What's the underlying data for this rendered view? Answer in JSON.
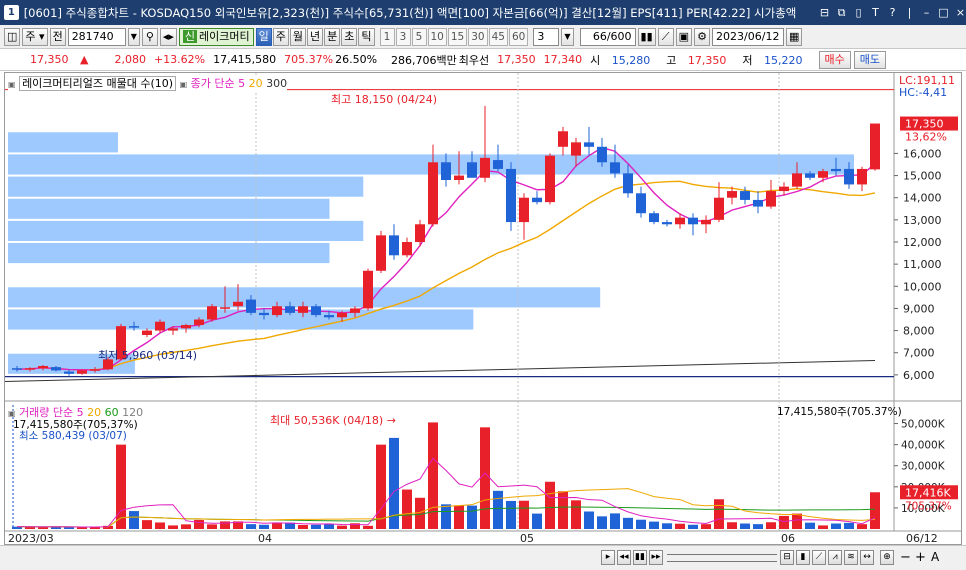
{
  "titlebar": {
    "icon_label": "1",
    "title": "[0601] 주식종합차트 - KOSDAQ150 외국인보유[2,323(천)] 주식수[65,731(천)] 액면[100] 자본금[66(억)] 결산[12월] EPS[411] PER[42.22] 시가총액",
    "buttons": [
      "⊟",
      "⧉",
      "▯",
      "T",
      "?",
      "|",
      "–",
      "□",
      "×"
    ]
  },
  "toolbar1": {
    "period_label": "주",
    "prev_label": "전",
    "stock_code": "281740",
    "company_badge": "신",
    "company_name": "레이크머티",
    "periods": [
      "일",
      "주",
      "월",
      "년",
      "분",
      "초",
      "틱"
    ],
    "active_period": "일",
    "intervals": [
      "1",
      "3",
      "5",
      "10",
      "15",
      "30",
      "45",
      "60"
    ],
    "interval_value": "3",
    "count_value": "66",
    "count_total": "/600",
    "date_value": "2023/06/12"
  },
  "quote": {
    "price": "17,350",
    "change_arrow": "▲",
    "change": "2,080",
    "change_pct": "+13.62%",
    "volume": "17,415,580",
    "vol_ratio": "705.37%",
    "turnover": "26.50%",
    "amount": "286,706백만",
    "best_ask_label": "최우선",
    "best_ask": "17,350",
    "best_bid": "17,340",
    "open_label": "시",
    "open": "15,280",
    "high_label": "고",
    "high": "17,350",
    "low_label": "저",
    "low": "15,220",
    "buy_label": "매수",
    "sell_label": "매도"
  },
  "price_legend": {
    "title": "레이크머티리얼즈 매물대 수(10)",
    "ma_label": "종가 단순",
    "ma_periods": [
      "5",
      "20",
      "300"
    ],
    "ma_colors": [
      "#e020c0",
      "#f0a800",
      "#333333"
    ]
  },
  "vol_legend": {
    "title": "거래량 단순",
    "ma_periods": [
      "5",
      "20",
      "60",
      "120"
    ],
    "ma_colors": [
      "#e020c0",
      "#f0a800",
      "#1a9a1a",
      "#808080"
    ],
    "last_label": "17,415,580주(705.37%)",
    "current_label": "17,415,580주(705,37%)",
    "min_label": "최소 580,439 (03/07)"
  },
  "annotations": {
    "price_high": "최고 18,150 (04/24)",
    "price_low": "최저 5,960 (03/14)",
    "vol_high": "최대 50,536K (04/18)",
    "lc": "LC:191,11",
    "hc": "HC:-4,41",
    "current_price_tag": "17,350",
    "current_pct_tag": "13,62%",
    "vol_tag": "17,416K",
    "vol_pct_tag": "705,37%"
  },
  "x_labels": [
    "2023/03",
    "04",
    "05",
    "06",
    "06/12"
  ],
  "colors": {
    "up": "#e8202a",
    "down": "#1f63d6",
    "profile": "#8cc0ff"
  },
  "chart_data": [
    {
      "type": "candlestick",
      "ylim": [
        5000,
        19000
      ],
      "yticks": [
        "6,000",
        "7,000",
        "8,000",
        "9,000",
        "10,000",
        "11,000",
        "12,000",
        "13,000",
        "14,000",
        "15,000",
        "16,000"
      ],
      "volume_profile_levels": [
        {
          "low": 16000,
          "high": 17000,
          "weight": 0.13
        },
        {
          "low": 15000,
          "high": 16000,
          "weight": 1.0
        },
        {
          "low": 14000,
          "high": 15000,
          "weight": 0.42
        },
        {
          "low": 13000,
          "high": 14000,
          "weight": 0.38
        },
        {
          "low": 12000,
          "high": 13000,
          "weight": 0.42
        },
        {
          "low": 11000,
          "high": 12000,
          "weight": 0.38
        },
        {
          "low": 10000,
          "high": 11000,
          "weight": 0.0
        },
        {
          "low": 9000,
          "high": 10000,
          "weight": 0.7
        },
        {
          "low": 8000,
          "high": 9000,
          "weight": 0.55
        },
        {
          "low": 7000,
          "high": 8000,
          "weight": 0.0
        },
        {
          "low": 6000,
          "high": 7000,
          "weight": 0.15
        }
      ],
      "candles": [
        {
          "o": 6300,
          "h": 6400,
          "l": 6150,
          "c": 6250
        },
        {
          "o": 6250,
          "h": 6350,
          "l": 6150,
          "c": 6300
        },
        {
          "o": 6300,
          "h": 6450,
          "l": 6200,
          "c": 6400
        },
        {
          "o": 6350,
          "h": 6400,
          "l": 6150,
          "c": 6200
        },
        {
          "o": 6150,
          "h": 6250,
          "l": 5960,
          "c": 6050
        },
        {
          "o": 6050,
          "h": 6250,
          "l": 6000,
          "c": 6200
        },
        {
          "o": 6200,
          "h": 6350,
          "l": 6100,
          "c": 6250
        },
        {
          "o": 6250,
          "h": 6800,
          "l": 6200,
          "c": 6700
        },
        {
          "o": 6700,
          "h": 8300,
          "l": 6650,
          "c": 8200
        },
        {
          "o": 8200,
          "h": 8400,
          "l": 8000,
          "c": 8150
        },
        {
          "o": 7800,
          "h": 8100,
          "l": 7700,
          "c": 8000
        },
        {
          "o": 8000,
          "h": 8500,
          "l": 7900,
          "c": 8400
        },
        {
          "o": 8000,
          "h": 8200,
          "l": 7800,
          "c": 8100
        },
        {
          "o": 8100,
          "h": 8300,
          "l": 7900,
          "c": 8250
        },
        {
          "o": 8250,
          "h": 8600,
          "l": 8150,
          "c": 8500
        },
        {
          "o": 8500,
          "h": 9200,
          "l": 8400,
          "c": 9100
        },
        {
          "o": 9000,
          "h": 10000,
          "l": 8800,
          "c": 9050
        },
        {
          "o": 9100,
          "h": 10100,
          "l": 8900,
          "c": 9300
        },
        {
          "o": 9400,
          "h": 9600,
          "l": 8700,
          "c": 8800
        },
        {
          "o": 8800,
          "h": 9000,
          "l": 8500,
          "c": 8700
        },
        {
          "o": 8700,
          "h": 9300,
          "l": 8600,
          "c": 9100
        },
        {
          "o": 9100,
          "h": 9300,
          "l": 8700,
          "c": 8800
        },
        {
          "o": 8800,
          "h": 9300,
          "l": 8600,
          "c": 9100
        },
        {
          "o": 9100,
          "h": 9200,
          "l": 8600,
          "c": 8700
        },
        {
          "o": 8700,
          "h": 8900,
          "l": 8500,
          "c": 8600
        },
        {
          "o": 8600,
          "h": 8900,
          "l": 8400,
          "c": 8800
        },
        {
          "o": 8800,
          "h": 9100,
          "l": 8600,
          "c": 9000
        },
        {
          "o": 9000,
          "h": 10800,
          "l": 8900,
          "c": 10700
        },
        {
          "o": 10700,
          "h": 12500,
          "l": 10600,
          "c": 12300
        },
        {
          "o": 12300,
          "h": 12800,
          "l": 11200,
          "c": 11400
        },
        {
          "o": 11400,
          "h": 12200,
          "l": 11300,
          "c": 12000
        },
        {
          "o": 12000,
          "h": 13000,
          "l": 11800,
          "c": 12800
        },
        {
          "o": 12800,
          "h": 16400,
          "l": 12700,
          "c": 15600
        },
        {
          "o": 15600,
          "h": 16000,
          "l": 14500,
          "c": 14800
        },
        {
          "o": 14800,
          "h": 16100,
          "l": 14600,
          "c": 15000
        },
        {
          "o": 15600,
          "h": 16100,
          "l": 15000,
          "c": 14900
        },
        {
          "o": 14900,
          "h": 18150,
          "l": 14700,
          "c": 15800
        },
        {
          "o": 15700,
          "h": 16400,
          "l": 15200,
          "c": 15300
        },
        {
          "o": 15300,
          "h": 15600,
          "l": 12500,
          "c": 12900
        },
        {
          "o": 12900,
          "h": 14200,
          "l": 12100,
          "c": 14000
        },
        {
          "o": 14000,
          "h": 14300,
          "l": 13700,
          "c": 13800
        },
        {
          "o": 13800,
          "h": 16000,
          "l": 13700,
          "c": 15900
        },
        {
          "o": 16300,
          "h": 17200,
          "l": 15900,
          "c": 17000
        },
        {
          "o": 15900,
          "h": 16700,
          "l": 15400,
          "c": 16500
        },
        {
          "o": 16500,
          "h": 17200,
          "l": 15900,
          "c": 16300
        },
        {
          "o": 16300,
          "h": 16700,
          "l": 15400,
          "c": 15600
        },
        {
          "o": 15600,
          "h": 16400,
          "l": 14900,
          "c": 15100
        },
        {
          "o": 15100,
          "h": 15500,
          "l": 14000,
          "c": 14200
        },
        {
          "o": 14200,
          "h": 14500,
          "l": 13100,
          "c": 13300
        },
        {
          "o": 13300,
          "h": 13400,
          "l": 12800,
          "c": 12900
        },
        {
          "o": 12900,
          "h": 13000,
          "l": 12700,
          "c": 12800
        },
        {
          "o": 12800,
          "h": 13300,
          "l": 12600,
          "c": 13100
        },
        {
          "o": 13100,
          "h": 13300,
          "l": 12300,
          "c": 12800
        },
        {
          "o": 12800,
          "h": 13200,
          "l": 12400,
          "c": 13000
        },
        {
          "o": 13000,
          "h": 14700,
          "l": 12900,
          "c": 14000
        },
        {
          "o": 14000,
          "h": 14500,
          "l": 13700,
          "c": 14300
        },
        {
          "o": 14300,
          "h": 14500,
          "l": 13700,
          "c": 13900
        },
        {
          "o": 13900,
          "h": 14300,
          "l": 13300,
          "c": 13600
        },
        {
          "o": 13600,
          "h": 14800,
          "l": 13500,
          "c": 14300
        },
        {
          "o": 14300,
          "h": 14700,
          "l": 14100,
          "c": 14500
        },
        {
          "o": 14500,
          "h": 15600,
          "l": 14400,
          "c": 15100
        },
        {
          "o": 15100,
          "h": 15200,
          "l": 14800,
          "c": 14900
        },
        {
          "o": 14900,
          "h": 15300,
          "l": 14700,
          "c": 15200
        },
        {
          "o": 15300,
          "h": 15800,
          "l": 15000,
          "c": 15200
        },
        {
          "o": 15300,
          "h": 15600,
          "l": 14400,
          "c": 14600
        },
        {
          "o": 14600,
          "h": 15400,
          "l": 14300,
          "c": 15300
        },
        {
          "o": 15280,
          "h": 17350,
          "l": 15220,
          "c": 17350
        }
      ]
    },
    {
      "type": "bar",
      "series_name": "거래량",
      "ylim": [
        0,
        55000
      ],
      "yticks": [
        "10,000K",
        "20,000K",
        "30,000K",
        "40,000K",
        "50,000K"
      ],
      "values": [
        1100,
        1000,
        900,
        1200,
        800,
        700,
        1000,
        1500,
        40000,
        8500,
        4200,
        3100,
        1700,
        2200,
        4300,
        2200,
        3600,
        3600,
        2300,
        2000,
        3100,
        3000,
        1900,
        2000,
        2200,
        1600,
        2700,
        1500,
        40000,
        43200,
        18700,
        14800,
        50536,
        11700,
        11200,
        11100,
        48200,
        18100,
        13300,
        13400,
        7300,
        22400,
        17900,
        13600,
        8300,
        6000,
        7400,
        5300,
        4400,
        3500,
        2700,
        2500,
        2000,
        2300,
        14100,
        3200,
        2600,
        2300,
        3200,
        6200,
        7300,
        3000,
        1700,
        2600,
        2900,
        2300,
        17416
      ]
    }
  ]
}
